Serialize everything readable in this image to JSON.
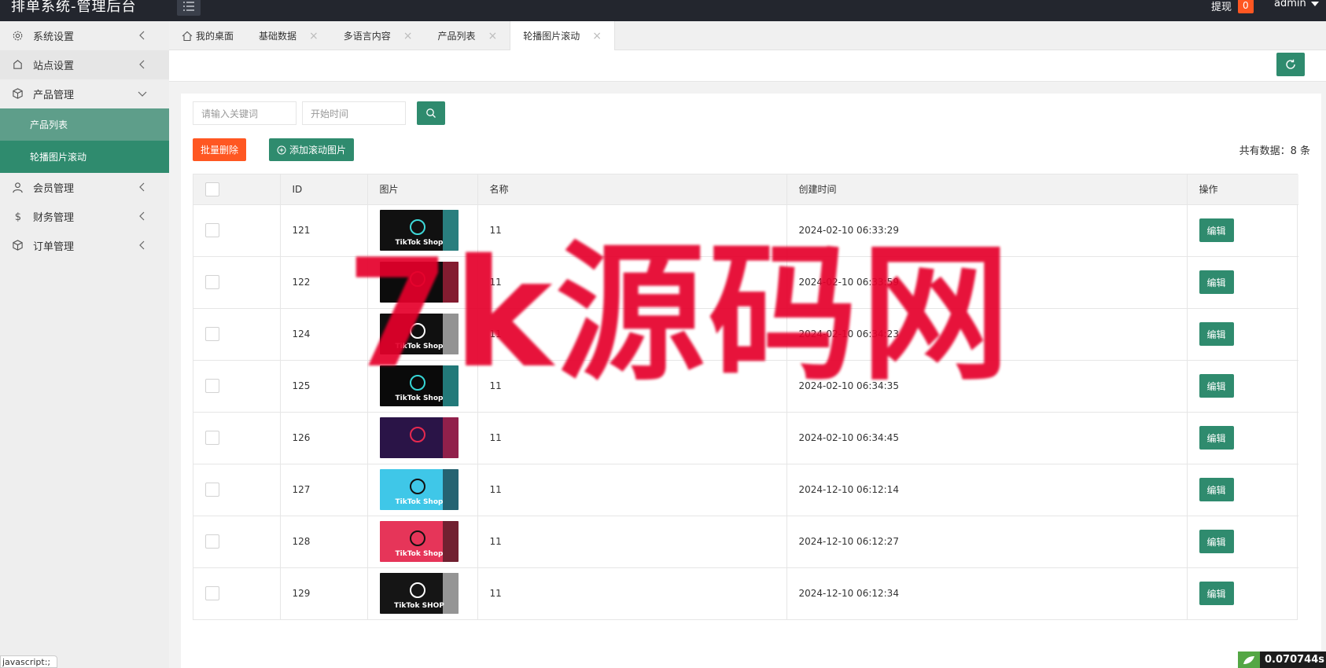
{
  "header": {
    "title": "排单系统-管理后台",
    "withdraw_label": "提现",
    "withdraw_count": "0",
    "user": "admin"
  },
  "sidebar": {
    "items": [
      {
        "label": "系统设置",
        "icon": "gear-icon",
        "expanded": false
      },
      {
        "label": "站点设置",
        "icon": "site-icon",
        "expanded": false
      },
      {
        "label": "产品管理",
        "icon": "cube-icon",
        "expanded": true
      },
      {
        "label": "会员管理",
        "icon": "user-icon",
        "expanded": false
      },
      {
        "label": "财务管理",
        "icon": "dollar-icon",
        "expanded": false
      },
      {
        "label": "订单管理",
        "icon": "order-icon",
        "expanded": false
      }
    ],
    "sub_items": [
      {
        "label": "产品列表"
      },
      {
        "label": "轮播图片滚动"
      }
    ]
  },
  "tabs": [
    {
      "label": "我的桌面"
    },
    {
      "label": "基础数据"
    },
    {
      "label": "多语言内容"
    },
    {
      "label": "产品列表"
    },
    {
      "label": "轮播图片滚动"
    }
  ],
  "toolbar": {
    "keyword_placeholder": "请输入关键词",
    "start_time_placeholder": "开始时间",
    "batch_delete_label": "批量删除",
    "add_label": "添加滚动图片",
    "total_text": "共有数据：8 条"
  },
  "table": {
    "columns": [
      "ID",
      "图片",
      "名称",
      "创建时间",
      "操作"
    ],
    "edit_label": "编辑",
    "rows": [
      {
        "id": "121",
        "name": "11",
        "created": "2024-02-10 06:33:29",
        "thumb": "#111111",
        "accent": "#3ed8d8",
        "thumb_text": "TikTok Shop"
      },
      {
        "id": "122",
        "name": "11",
        "created": "2024-02-10 06:33:59",
        "thumb": "#0c0c0c",
        "accent": "#e6294f",
        "thumb_text": ""
      },
      {
        "id": "124",
        "name": "11",
        "created": "2024-02-10 06:34:23",
        "thumb": "#101010",
        "accent": "#ffffff",
        "thumb_text": "TikTok Shop"
      },
      {
        "id": "125",
        "name": "11",
        "created": "2024-02-10 06:34:35",
        "thumb": "#0a0a0a",
        "accent": "#36d5d5",
        "thumb_text": "TikTok Shop"
      },
      {
        "id": "126",
        "name": "11",
        "created": "2024-02-10 06:34:45",
        "thumb": "#2a1447",
        "accent": "#e6294f",
        "thumb_text": ""
      },
      {
        "id": "127",
        "name": "11",
        "created": "2024-12-10 06:12:14",
        "thumb": "#3fc7e8",
        "accent": "#111111",
        "thumb_text": "TikTok Shop"
      },
      {
        "id": "128",
        "name": "11",
        "created": "2024-12-10 06:12:27",
        "thumb": "#e63559",
        "accent": "#111111",
        "thumb_text": "TikTok Shop"
      },
      {
        "id": "129",
        "name": "11",
        "created": "2024-12-10 06:12:34",
        "thumb": "#151515",
        "accent": "#ffffff",
        "thumb_text": "TikTok SHOP"
      }
    ]
  },
  "watermark": "7k源码网",
  "status": {
    "url_hint": "javascript:;",
    "timer": "0.070744s"
  },
  "colors": {
    "primary": "#2f8b6e",
    "danger": "#ff5722",
    "topbar": "#23262e"
  }
}
